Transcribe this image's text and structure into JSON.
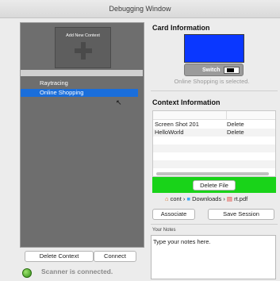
{
  "window": {
    "title": "Debugging Window"
  },
  "contexts": {
    "add_label": "Add New Context",
    "items": [
      "Raytracing",
      "Online Shopping"
    ],
    "delete_label": "Delete Context",
    "connect_label": "Connect"
  },
  "status": {
    "text": "Scanner is connected.",
    "color": "#2f8e14"
  },
  "card": {
    "title": "Card Information",
    "color": "#0a37ff",
    "switch_label": "Switch",
    "selected_caption": "Online Shopping is selected."
  },
  "context_info": {
    "title": "Context Information",
    "rows": [
      {
        "name": "Screen Shot 201",
        "action": "Delete"
      },
      {
        "name": "HelloWorld",
        "action": "Delete"
      }
    ],
    "delete_file_label": "Delete File",
    "path": {
      "part1": "cont",
      "part2": "Downloads",
      "part3": "rt.pdf"
    },
    "associate_label": "Associate",
    "save_label": "Save Session"
  },
  "notes": {
    "label": "Your Notes",
    "placeholder": "Type your notes here."
  },
  "accent": "#1a6edb",
  "highlight_green": "#19d319"
}
